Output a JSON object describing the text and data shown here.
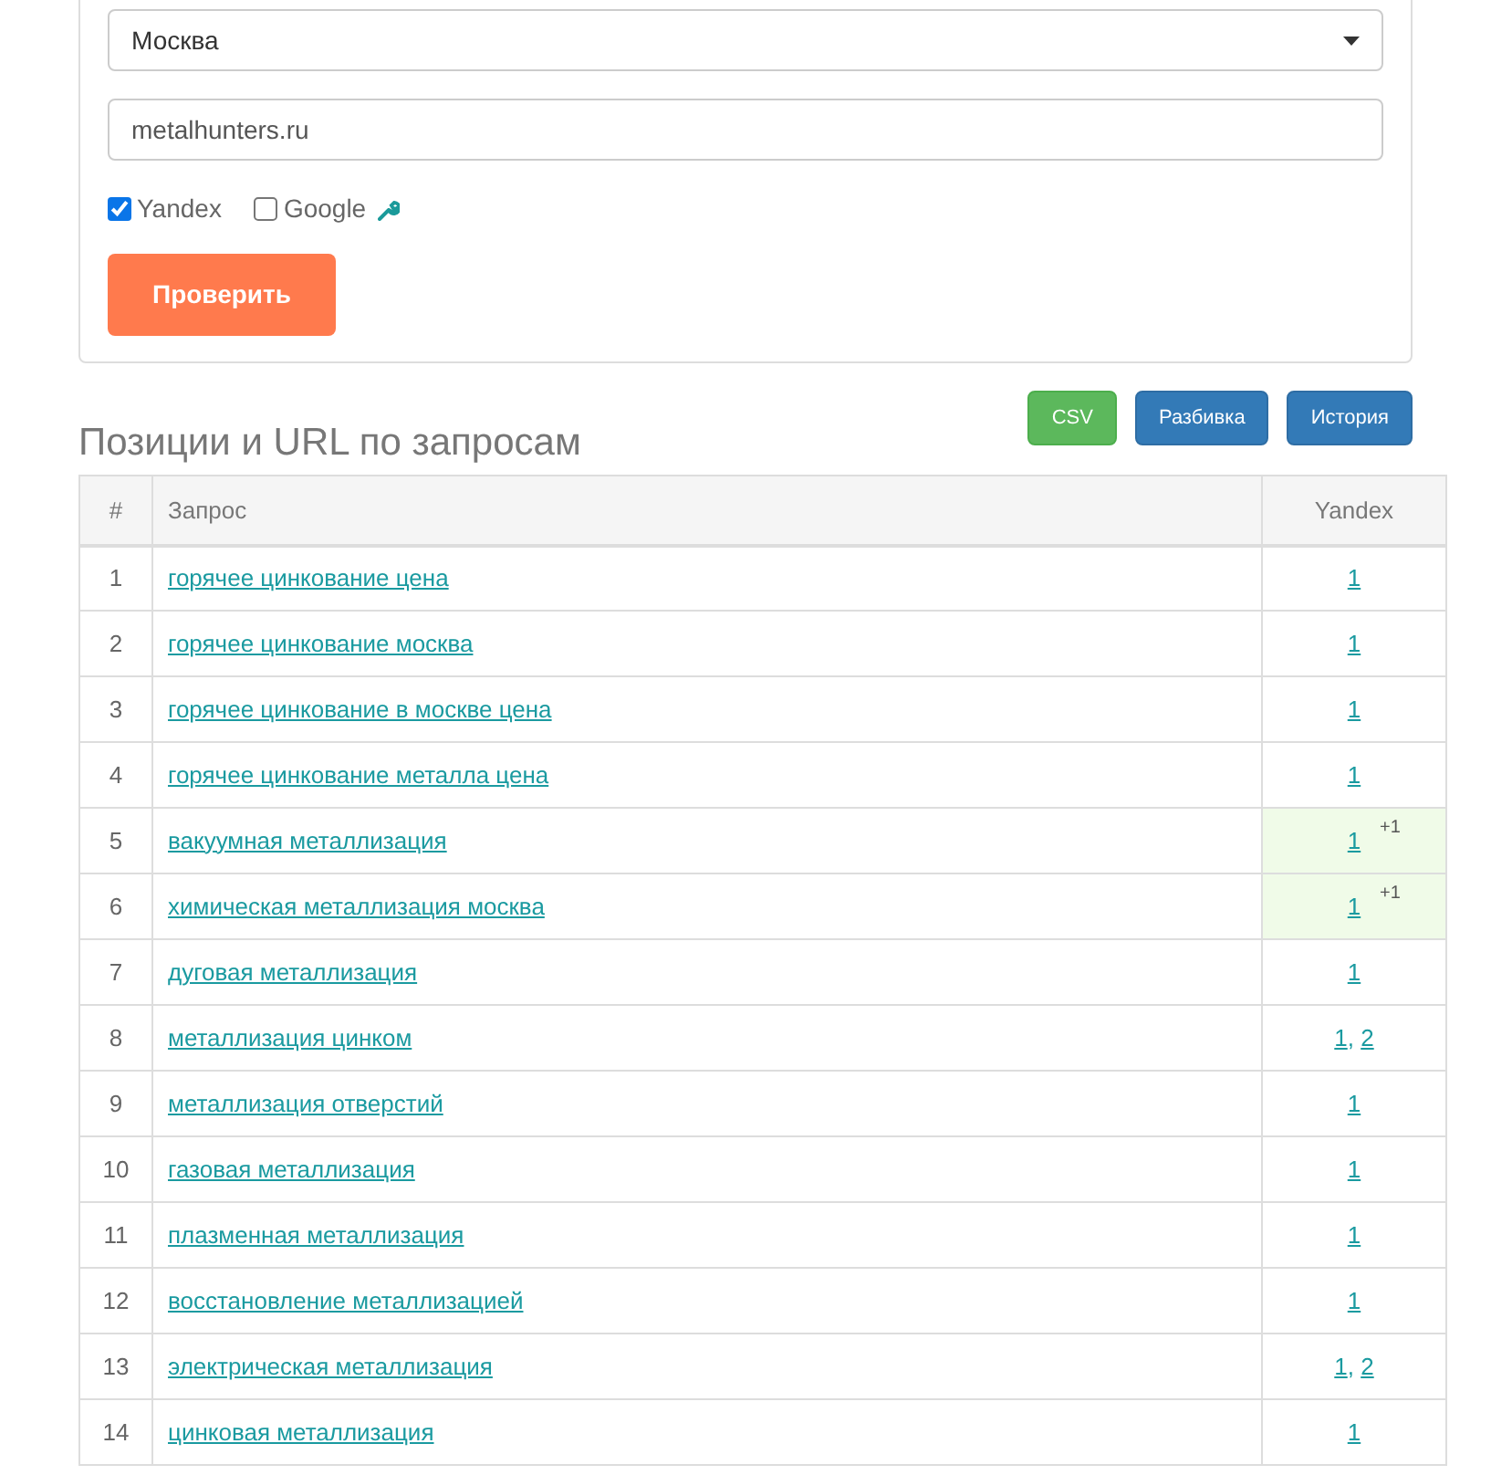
{
  "form": {
    "region": {
      "value": "Москва"
    },
    "site": {
      "value": "metalhunters.ru"
    },
    "engines": [
      {
        "label": "Yandex",
        "checked": true
      },
      {
        "label": "Google",
        "checked": false
      }
    ],
    "submit": "Проверить"
  },
  "results": {
    "title": "Позиции и URL по запросам",
    "buttons": [
      {
        "label": "CSV",
        "kind": "success"
      },
      {
        "label": "Разбивка",
        "kind": "primary"
      },
      {
        "label": "История",
        "kind": "primary"
      }
    ],
    "columns": [
      "#",
      "Запрос",
      "Yandex"
    ],
    "position_separator": ", ",
    "rows": [
      {
        "n": "1",
        "query": "горячее цинкование цена",
        "positions": [
          "1"
        ],
        "highlighted": false
      },
      {
        "n": "2",
        "query": "горячее цинкование москва",
        "positions": [
          "1"
        ],
        "highlighted": false
      },
      {
        "n": "3",
        "query": "горячее цинкование в москве цена",
        "positions": [
          "1"
        ],
        "highlighted": false
      },
      {
        "n": "4",
        "query": "горячее цинкование металла цена",
        "positions": [
          "1"
        ],
        "highlighted": false
      },
      {
        "n": "5",
        "query": "вакуумная металлизация",
        "positions": [
          "1"
        ],
        "change": "+1",
        "highlighted": true
      },
      {
        "n": "6",
        "query": "химическая металлизация москва",
        "positions": [
          "1"
        ],
        "change": "+1",
        "highlighted": true
      },
      {
        "n": "7",
        "query": "дуговая металлизация",
        "positions": [
          "1"
        ],
        "highlighted": false
      },
      {
        "n": "8",
        "query": "металлизация цинком",
        "positions": [
          "1",
          "2"
        ],
        "highlighted": false
      },
      {
        "n": "9",
        "query": "металлизация отверстий",
        "positions": [
          "1"
        ],
        "highlighted": false
      },
      {
        "n": "10",
        "query": "газовая металлизация",
        "positions": [
          "1"
        ],
        "highlighted": false
      },
      {
        "n": "11",
        "query": "плазменная металлизация",
        "positions": [
          "1"
        ],
        "highlighted": false
      },
      {
        "n": "12",
        "query": "восстановление металлизацией",
        "positions": [
          "1"
        ],
        "highlighted": false
      },
      {
        "n": "13",
        "query": "электрическая металлизация",
        "positions": [
          "1",
          "2"
        ],
        "highlighted": false
      },
      {
        "n": "14",
        "query": "цинковая металлизация",
        "positions": [
          "1"
        ],
        "highlighted": false
      }
    ]
  }
}
